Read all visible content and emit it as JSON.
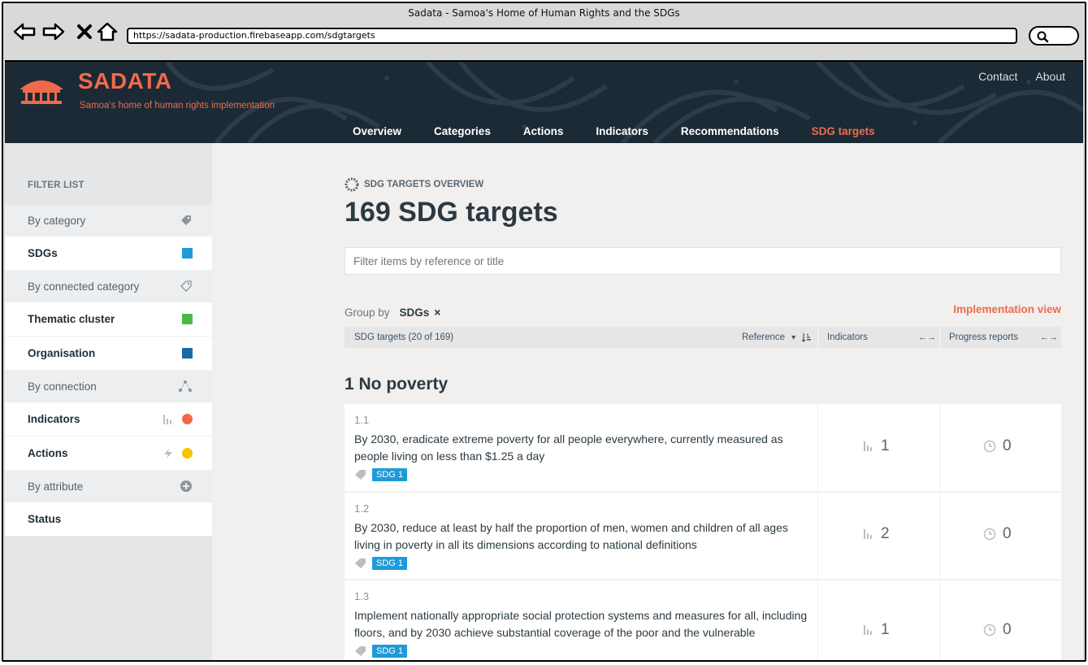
{
  "browser": {
    "window_title": "Sadata - Samoa's Home of Human Rights and the SDGs",
    "url": "https://sadata-production.firebaseapp.com/sdgtargets"
  },
  "site": {
    "brand": "SADATA",
    "tagline": "Samoa's home of human rights implementation",
    "top_links": [
      "Contact",
      "About"
    ],
    "nav": [
      "Overview",
      "Categories",
      "Actions",
      "Indicators",
      "Recommendations",
      "SDG targets"
    ],
    "active_nav": "SDG targets",
    "accent": "#ef6a4c",
    "header_bg": "#1b2a35"
  },
  "sidebar": {
    "heading": "FILTER LIST",
    "by_category": "By category",
    "sdgs": "SDGs",
    "by_connected_category": "By connected category",
    "thematic_cluster": "Thematic cluster",
    "organisation": "Organisation",
    "by_connection": "By connection",
    "indicators": "Indicators",
    "actions": "Actions",
    "by_attribute": "By attribute",
    "status": "Status",
    "colors": {
      "sdgs": "#1f9ad9",
      "thematic_cluster": "#4db848",
      "organisation": "#1a6aa5",
      "indicators": "#ef6a4c",
      "actions": "#f7c200"
    }
  },
  "main": {
    "eyebrow": "SDG TARGETS OVERVIEW",
    "title": "169 SDG targets",
    "filter_placeholder": "Filter items by reference or title",
    "group_by_label": "Group by",
    "group_by_value": "SDGs",
    "group_by_clear": "×",
    "implementation_view": "Implementation view",
    "table_header": {
      "count": "SDG targets (20 of 169)",
      "sort_label": "Reference",
      "sort_caret": "▾",
      "indicators": "Indicators",
      "progress_reports": "Progress reports",
      "expand": "←→"
    },
    "group_title": "1 No poverty",
    "rows": [
      {
        "ref": "1.1",
        "desc": "By 2030, eradicate extreme poverty for all people everywhere, currently measured as people living on less than $1.25 a day",
        "tag": "SDG 1",
        "indicators": "1",
        "progress": "0"
      },
      {
        "ref": "1.2",
        "desc": "By 2030, reduce at least by half the proportion of men, women and children of all ages living in poverty in all its dimensions according to national definitions",
        "tag": "SDG 1",
        "indicators": "2",
        "progress": "0"
      },
      {
        "ref": "1.3",
        "desc": "Implement nationally appropriate social protection systems and measures for all, including floors, and by 2030 achieve substantial coverage of the poor and the vulnerable",
        "tag": "SDG 1",
        "indicators": "1",
        "progress": "0"
      }
    ]
  }
}
